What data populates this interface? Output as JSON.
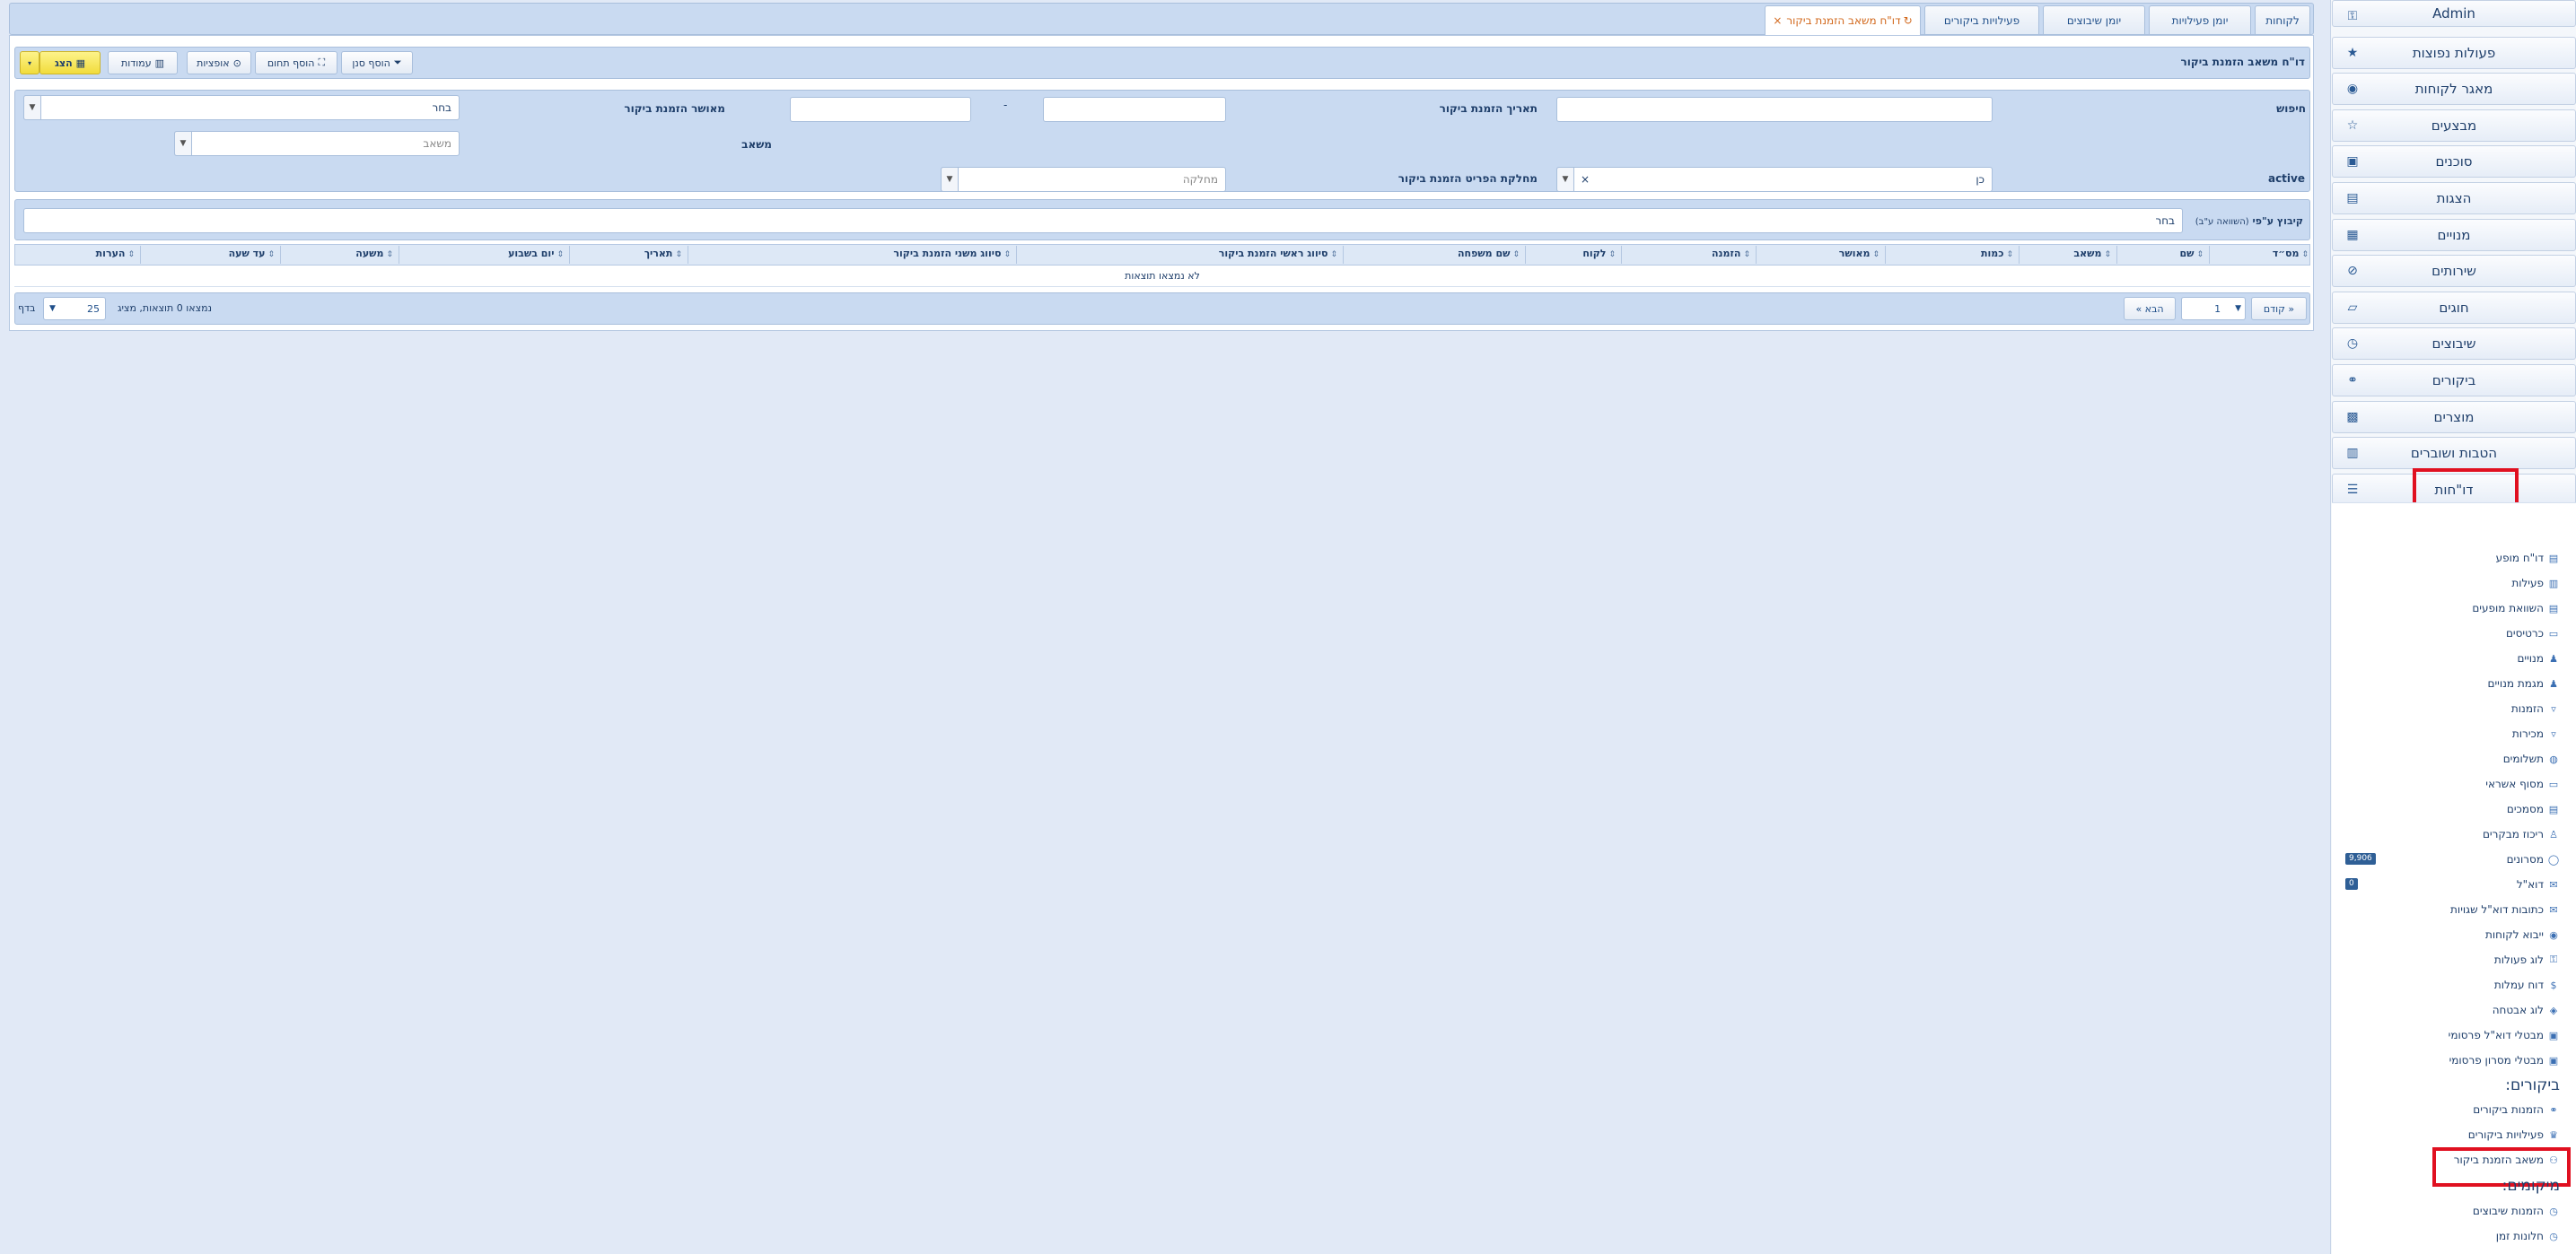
{
  "tabs": [
    {
      "label": "לקוחות"
    },
    {
      "label": "יומן פעילויות"
    },
    {
      "label": "יומן שיבוצים"
    },
    {
      "label": "פעילויות ביקורים"
    },
    {
      "label": "דו\"ח משאב הזמנת ביקור",
      "refresh_icon": "↻",
      "close_icon": "×"
    }
  ],
  "header": {
    "title": "דו\"ח משאב הזמנת ביקור",
    "buttons": {
      "add_filter": "הוסף סנן",
      "add_range": "הוסף תחום",
      "options": "אופציות",
      "columns": "עמודות",
      "show": "הצג"
    }
  },
  "filters": {
    "search_label": "חיפוש",
    "visit_date_label": "תאריך הזמנת ביקור",
    "date_separator": "-",
    "approver_label": "מאושר הזמנת ביקור",
    "approver_value": "בחר",
    "resource_label": "משאב",
    "resource_placeholder": "משאב",
    "active_label": "active",
    "active_value": "כן",
    "active_clear": "×",
    "department_label": "מחלקת הפריט הזמנת ביקור",
    "department_placeholder": "מחלקה"
  },
  "grouping": {
    "label": "קיבוץ ע\"פי",
    "hint": "(השוואה ע\"ב)",
    "value": "בחר"
  },
  "table": {
    "columns": [
      "מס״ד",
      "שם",
      "משאב",
      "כמות",
      "מאושר",
      "הזמנה",
      "לקוח",
      "שם משפחה",
      "סיווג ראשי הזמנת ביקור",
      "סיווג משני הזמנת ביקור",
      "תאריך",
      "יום בשבוע",
      "משעה",
      "עד שעה",
      "הערות"
    ],
    "empty_text": "לא נמצאו תוצאות"
  },
  "pagination": {
    "prev": "« קודם",
    "page": "1",
    "next": "הבא »",
    "results_text": "נמצאו 0 תוצאות, מציג",
    "per_page": "25",
    "per_page_suffix": "בדף"
  },
  "sidebar": {
    "items": [
      {
        "label": "Admin",
        "icon": "key-icon"
      },
      {
        "label": "פעולות נפוצות",
        "icon": "star-icon"
      },
      {
        "label": "מאגר לקוחות",
        "icon": "user-circle-icon"
      },
      {
        "label": "מבצעים",
        "icon": "star-outline-icon"
      },
      {
        "label": "סוכנים",
        "icon": "briefcase-icon"
      },
      {
        "label": "הצגות",
        "icon": "film-icon"
      },
      {
        "label": "מנויים",
        "icon": "id-card-icon"
      },
      {
        "label": "שירותים",
        "icon": "link-icon"
      },
      {
        "label": "חוגים",
        "icon": "teacher-icon"
      },
      {
        "label": "שיבוצים",
        "icon": "clock-icon"
      },
      {
        "label": "ביקורים",
        "icon": "handshake-icon"
      },
      {
        "label": "מוצרים",
        "icon": "boxes-icon"
      },
      {
        "label": "הטבות ושוברים",
        "icon": "gifts-icon"
      },
      {
        "label": "דו\"חות",
        "icon": "list-icon"
      }
    ],
    "report_items": [
      {
        "label": "דו\"ח מופע",
        "icon": "film-icon"
      },
      {
        "label": "פעילות",
        "icon": "chart-icon"
      },
      {
        "label": "השוואת מופעים",
        "icon": "film-icon"
      },
      {
        "label": "כרטיסים",
        "icon": "ticket-icon"
      },
      {
        "label": "מנויים",
        "icon": "person-icon"
      },
      {
        "label": "מגמת מנויים",
        "icon": "person-icon"
      },
      {
        "label": "הזמנות",
        "icon": "cart-icon"
      },
      {
        "label": "מכירות",
        "icon": "cart-icon"
      },
      {
        "label": "תשלומים",
        "icon": "coins-icon"
      },
      {
        "label": "מסוף אשראי",
        "icon": "credit-card-icon"
      },
      {
        "label": "מסמכים",
        "icon": "file-icon"
      },
      {
        "label": "ריכוז מבקרים",
        "icon": "walking-icon"
      },
      {
        "label": "מסרונים",
        "icon": "chat-icon",
        "badge": "9,906"
      },
      {
        "label": "דוא\"ל",
        "icon": "envelope-icon",
        "badge": "0"
      },
      {
        "label": "כתובות דוא\"ל שגויות",
        "icon": "envelope-icon"
      },
      {
        "label": "ייבוא לקוחות",
        "icon": "user-circle-icon"
      },
      {
        "label": "לוג פעולות",
        "icon": "key-icon"
      },
      {
        "label": "דוח עמלות",
        "icon": "dollar-icon"
      },
      {
        "label": "לוג אבטחה",
        "icon": "shield-icon"
      },
      {
        "label": "מבטלי דוא\"ל פרסומי",
        "icon": "user-box-icon"
      },
      {
        "label": "מבטלי מסרון פרסומי",
        "icon": "user-box-icon"
      }
    ],
    "visits_heading": "ביקורים:",
    "visits_items": [
      {
        "label": "הזמנות ביקורים",
        "icon": "handshake-icon"
      },
      {
        "label": "פעילויות ביקורים",
        "icon": "activity-icon"
      },
      {
        "label": "משאב הזמנת ביקור",
        "icon": "resource-icon"
      }
    ],
    "locations_heading": "מיקומים:",
    "locations_items": [
      {
        "label": "הזמנות שיבוצים",
        "icon": "clock-icon"
      },
      {
        "label": "חלונות זמן",
        "icon": "clock-icon"
      }
    ]
  },
  "colors": {
    "accent": "#1f3f6b",
    "panel_blue": "#c9daf1",
    "highlight_red": "#e01020",
    "active_tab_orange": "#d2681c",
    "show_button_yellow": "#f1dc3c"
  }
}
